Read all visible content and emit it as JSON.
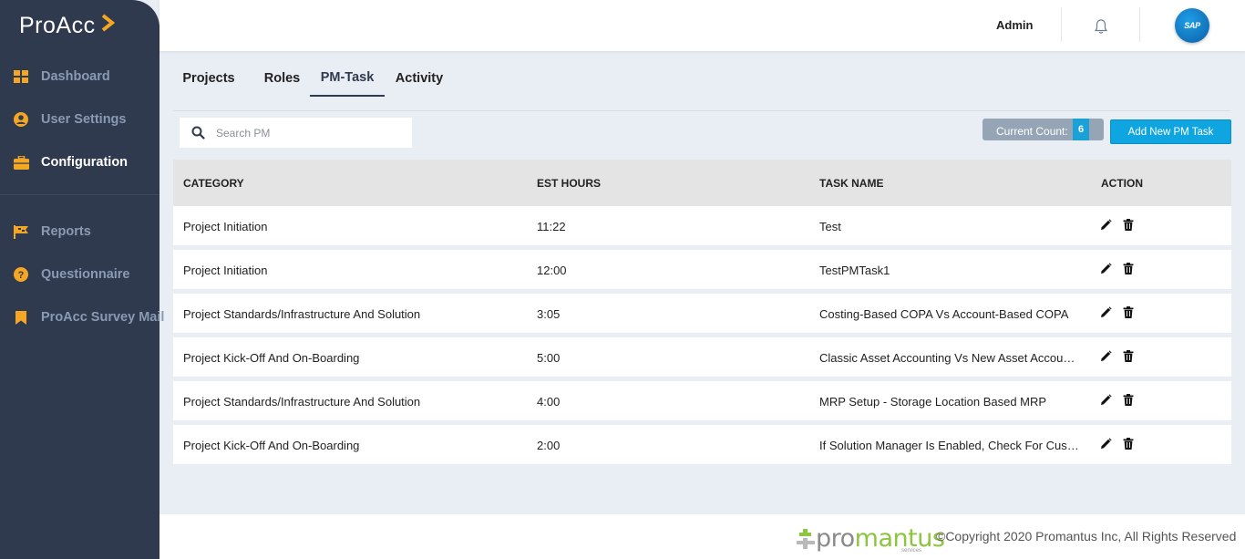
{
  "brand": {
    "name": "ProAcc",
    "accent": "#f5a623"
  },
  "sidebar": {
    "items": [
      {
        "label": "Dashboard",
        "icon": "grid-icon",
        "active": false
      },
      {
        "label": "User Settings",
        "icon": "user-circle-icon",
        "active": false
      },
      {
        "label": "Configuration",
        "icon": "briefcase-icon",
        "active": true
      },
      {
        "label": "Reports",
        "icon": "flag-icon",
        "active": false
      },
      {
        "label": "Questionnaire",
        "icon": "question-circle-icon",
        "active": false
      },
      {
        "label": "ProAcc Survey Mail",
        "icon": "bookmark-icon",
        "active": false
      }
    ]
  },
  "header": {
    "user": "Admin",
    "bell_icon": "bell-icon",
    "avatar_text": "SAP"
  },
  "tabs": [
    {
      "label": "Projects",
      "active": false
    },
    {
      "label": "Roles",
      "active": false
    },
    {
      "label": "PM-Task",
      "active": true
    },
    {
      "label": "Activity",
      "active": false
    }
  ],
  "search": {
    "placeholder": "Search PM",
    "value": ""
  },
  "count": {
    "label": "Current Count:",
    "value": "6"
  },
  "add_button": "Add New PM Task",
  "table": {
    "headers": [
      "CATEGORY",
      "EST HOURS",
      "TASK NAME",
      "ACTION"
    ],
    "rows": [
      {
        "category": "Project Initiation",
        "hours": "11:22",
        "task": "Test"
      },
      {
        "category": "Project Initiation",
        "hours": "12:00",
        "task": "TestPMTask1"
      },
      {
        "category": "Project Standards/Infrastructure And Solution",
        "hours": "3:05",
        "task": "Costing-Based COPA Vs Account-Based COPA"
      },
      {
        "category": "Project Kick-Off And On-Boarding",
        "hours": "5:00",
        "task": "Classic Asset Accounting Vs New Asset Accounting"
      },
      {
        "category": "Project Standards/Infrastructure And Solution",
        "hours": "4:00",
        "task": "MRP Setup - Storage Location Based MRP"
      },
      {
        "category": "Project Kick-Off And On-Boarding",
        "hours": "2:00",
        "task": "If Solution Manager Is Enabled, Check For Customizing"
      }
    ]
  },
  "footer": {
    "logo_prefix": "pro",
    "logo_suffix": "mantus",
    "logo_sub": "services",
    "copyright": "©Copyright 2020 Promantus Inc, All Rights Reserved"
  }
}
